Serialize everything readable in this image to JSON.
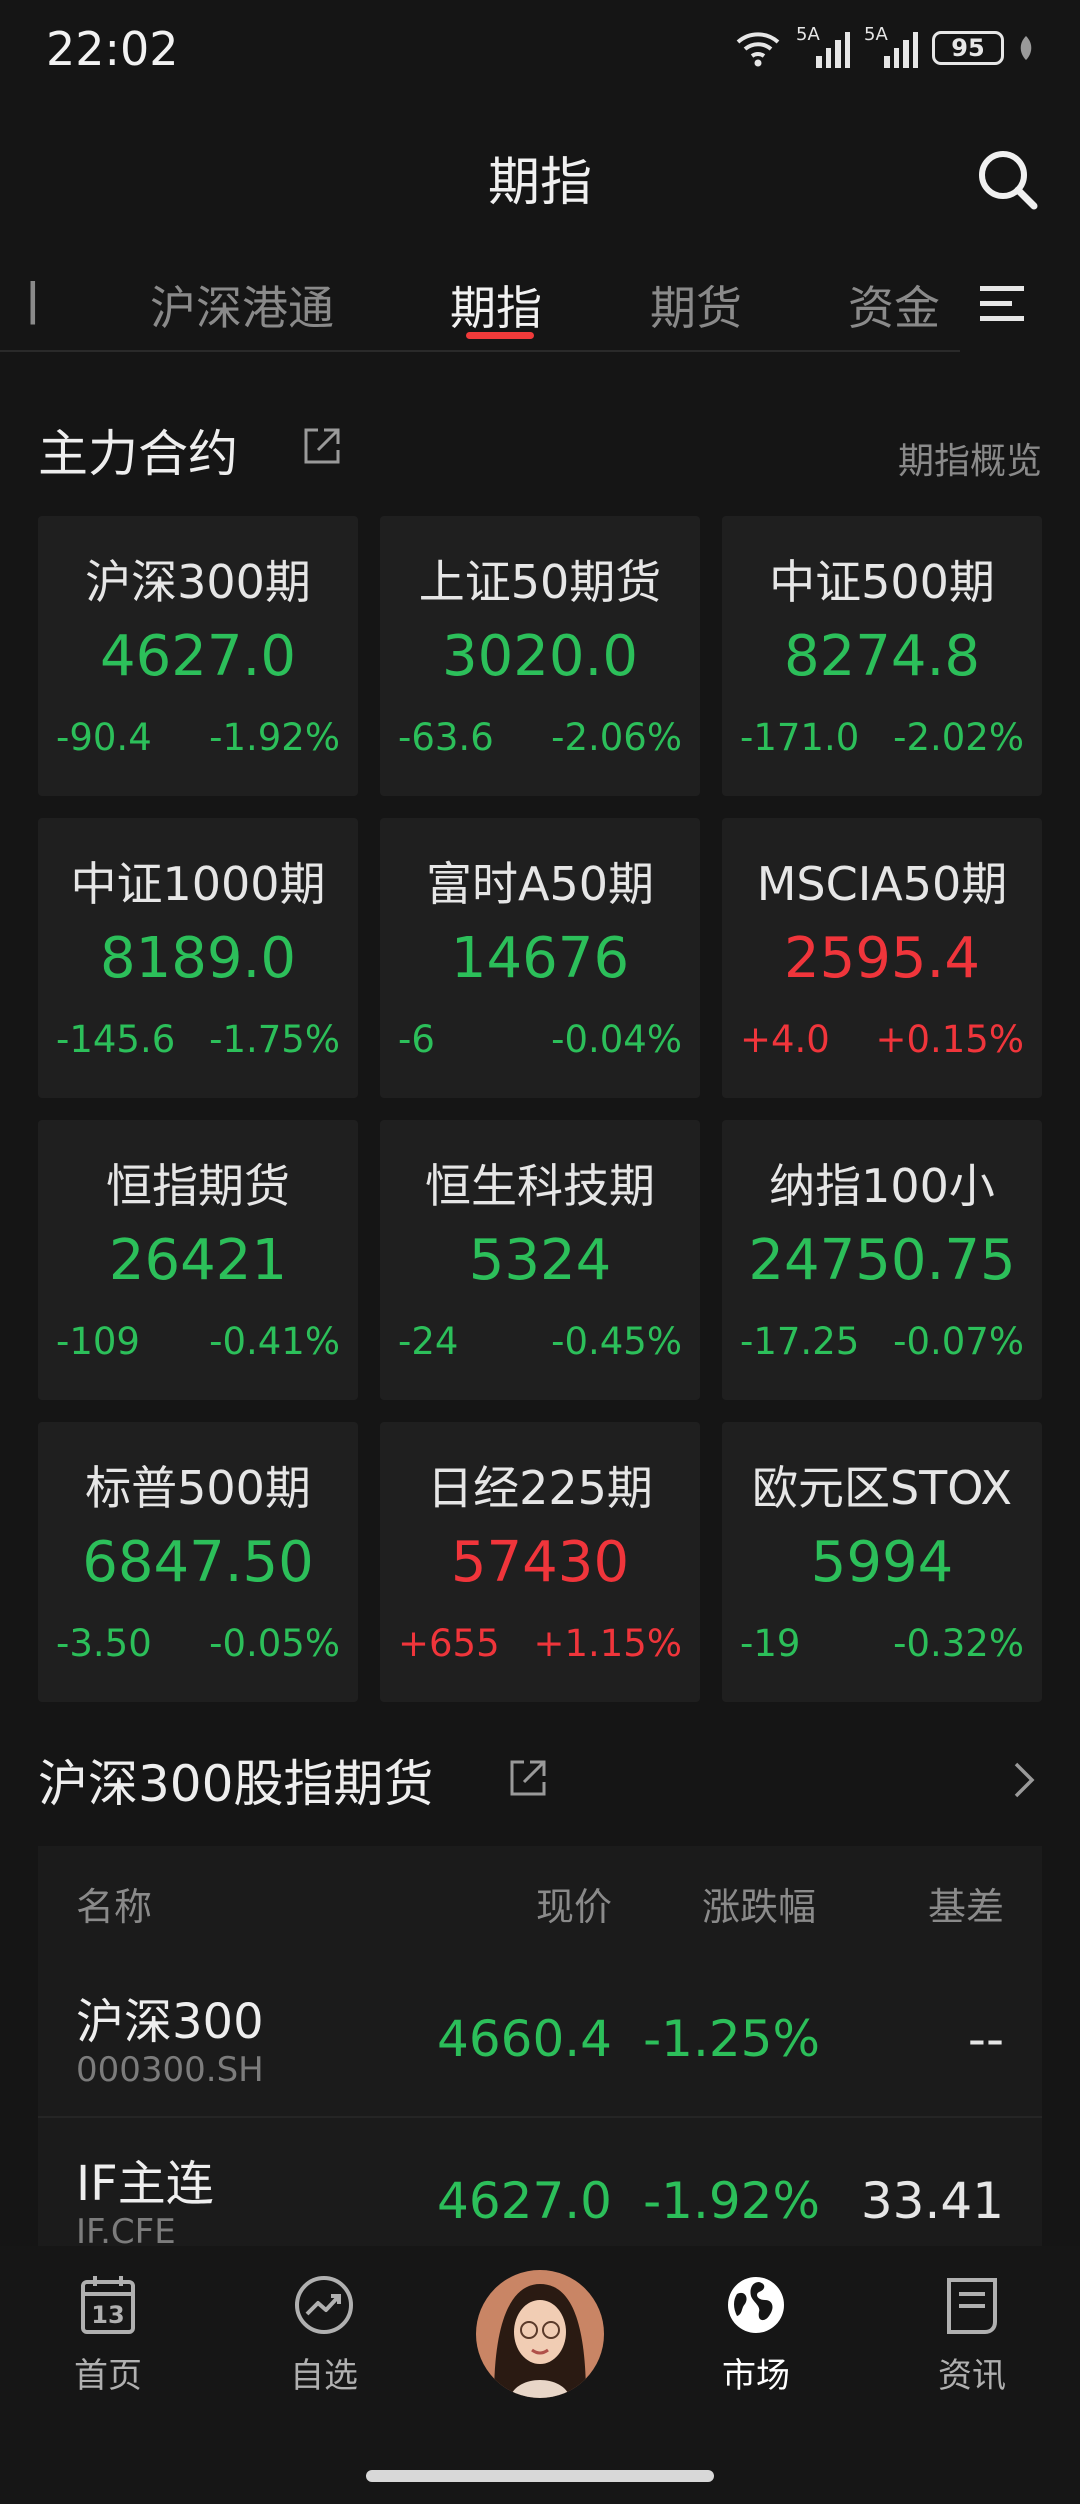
{
  "status_bar": {
    "time": "22:02",
    "signal1_label": "5A",
    "signal2_label": "5A",
    "battery": "95"
  },
  "header": {
    "title": "期指"
  },
  "tabs": {
    "items": [
      {
        "label": "沪深港通",
        "active": false
      },
      {
        "label": "期指",
        "active": true
      },
      {
        "label": "期货",
        "active": false
      },
      {
        "label": "资金",
        "active": false
      }
    ],
    "partial_left": "ǀ"
  },
  "main_contracts": {
    "title": "主力合约",
    "link": "期指概览",
    "cards": [
      {
        "name": "沪深300期",
        "price": "4627.0",
        "change": "-90.4",
        "pct": "-1.92%",
        "dir": "down"
      },
      {
        "name": "上证50期货",
        "price": "3020.0",
        "change": "-63.6",
        "pct": "-2.06%",
        "dir": "down"
      },
      {
        "name": "中证500期",
        "price": "8274.8",
        "change": "-171.0",
        "pct": "-2.02%",
        "dir": "down"
      },
      {
        "name": "中证1000期",
        "price": "8189.0",
        "change": "-145.6",
        "pct": "-1.75%",
        "dir": "down"
      },
      {
        "name": "富时A50期",
        "price": "14676",
        "change": "-6",
        "pct": "-0.04%",
        "dir": "down"
      },
      {
        "name": "MSCIA50期",
        "price": "2595.4",
        "change": "+4.0",
        "pct": "+0.15%",
        "dir": "up"
      },
      {
        "name": "恒指期货",
        "price": "26421",
        "change": "-109",
        "pct": "-0.41%",
        "dir": "down"
      },
      {
        "name": "恒生科技期",
        "price": "5324",
        "change": "-24",
        "pct": "-0.45%",
        "dir": "down"
      },
      {
        "name": "纳指100小",
        "price": "24750.75",
        "change": "-17.25",
        "pct": "-0.07%",
        "dir": "down"
      },
      {
        "name": "标普500期",
        "price": "6847.50",
        "change": "-3.50",
        "pct": "-0.05%",
        "dir": "down"
      },
      {
        "name": "日经225期",
        "price": "57430",
        "change": "+655",
        "pct": "+1.15%",
        "dir": "up"
      },
      {
        "name": "欧元区STOX",
        "price": "5994",
        "change": "-19",
        "pct": "-0.32%",
        "dir": "down"
      }
    ]
  },
  "futures_table": {
    "title": "沪深300股指期货",
    "headers": {
      "name": "名称",
      "price": "现价",
      "pct": "涨跌幅",
      "basis": "基差"
    },
    "rows": [
      {
        "name": "沪深300",
        "code": "000300.SH",
        "price": "4660.4",
        "pct": "-1.25%",
        "basis": "--",
        "dir": "down"
      },
      {
        "name": "IF主连",
        "code": "IF.CFE",
        "price": "4627.0",
        "pct": "-1.92%",
        "basis": "33.41",
        "dir": "down"
      }
    ]
  },
  "bottom_nav": {
    "items": [
      {
        "label": "首页",
        "icon": "calendar-icon",
        "active": false
      },
      {
        "label": "自选",
        "icon": "trend-icon",
        "active": false
      },
      {
        "label": "市场",
        "icon": "globe-icon",
        "active": true
      },
      {
        "label": "资讯",
        "icon": "news-icon",
        "active": false
      }
    ],
    "calendar_day": "13"
  },
  "colors": {
    "up": "#f0353b",
    "down": "#2cbf5a",
    "accent": "#f03a3a",
    "background": "#151515",
    "card": "#1f1f1f"
  }
}
